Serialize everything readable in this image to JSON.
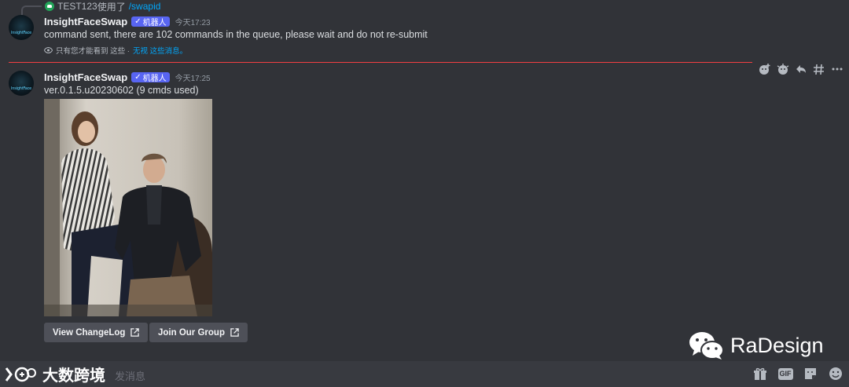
{
  "reply": {
    "user": "TEST123",
    "action": "使用了",
    "command": "/swapid"
  },
  "message1": {
    "username": "InsightFaceSwap",
    "bot_tag": "机器人",
    "timestamp": "今天17:23",
    "text": "command sent, there are 102 commands in the queue, please wait and do not re-submit",
    "ephemeral_note": "只有您才能看到 这些 ·",
    "ephemeral_dismiss": "无视 这些消息。"
  },
  "message2": {
    "username": "InsightFaceSwap",
    "bot_tag": "机器人",
    "timestamp": "今天17:25",
    "text": "ver.0.1.5.u20230602 (9 cmds used)",
    "buttons": [
      {
        "label": "View ChangeLog"
      },
      {
        "label": "Join Our Group"
      }
    ]
  },
  "avatar_text": "InsightFace",
  "toolbar": {
    "icons": [
      "add-reaction-icon",
      "add-super-reaction-icon",
      "reply-icon",
      "create-thread-icon",
      "more-icon"
    ]
  },
  "watermark": {
    "brand": "RaDesign",
    "logo_text": "大数跨境"
  },
  "composer": {
    "placeholder": "发消息",
    "icons": [
      "gift-icon",
      "gif-icon",
      "sticker-icon",
      "emoji-icon"
    ],
    "gif_label": "GIF"
  },
  "colors": {
    "background": "#313338",
    "bot_tag": "#5865f2",
    "link": "#00a8fc",
    "new_divider": "#f23f43",
    "button": "#4e5058"
  }
}
